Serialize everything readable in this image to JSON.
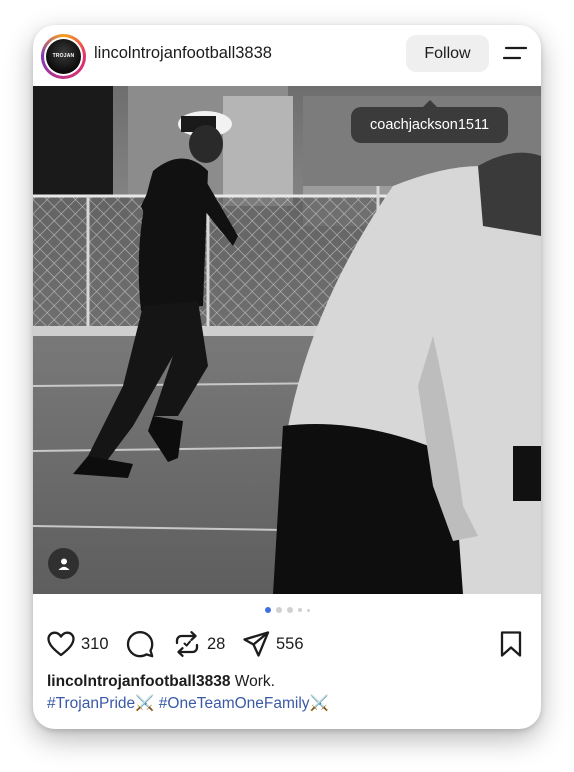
{
  "post": {
    "username": "lincolntrojanfootball3838",
    "avatar_text": "TROJAN FOOTBALL",
    "follow_label": "Follow",
    "tagged_user": "coachjackson1511",
    "carousel": {
      "total": 5,
      "active": 1
    },
    "likes": "310",
    "comments_icon": "comment-icon",
    "reposts": "28",
    "shares": "556",
    "caption_user": "lincolntrojanfootball3838",
    "caption_text": "Work.",
    "hashtags": [
      "#TrojanPride",
      "#OneTeamOneFamily"
    ],
    "hashtag_emoji": "⚔️"
  },
  "colors": {
    "accent": "#3f6fe0",
    "hashtag": "#3a5aa6",
    "follow_bg": "#efefef"
  }
}
